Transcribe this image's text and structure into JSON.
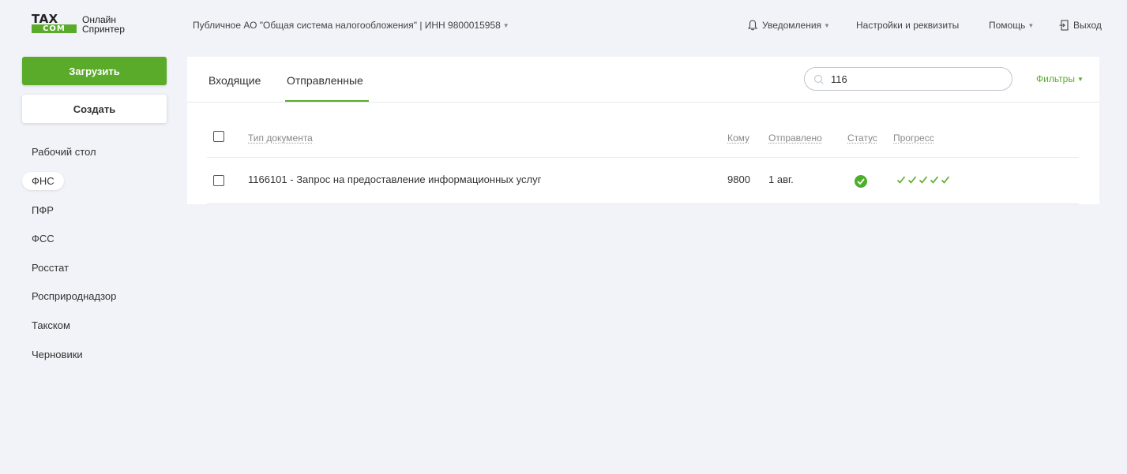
{
  "header": {
    "logo": {
      "mark_top": "TAX",
      "mark_bottom": "COM",
      "line1": "Онлайн",
      "line2": "Спринтер"
    },
    "organization": "Публичное АО \"Общая система налогообложения\" | ИНН 9800015958",
    "notifications_label": "Уведомления",
    "settings_label": "Настройки и реквизиты",
    "help_label": "Помощь",
    "logout_label": "Выход"
  },
  "sidebar": {
    "upload_label": "Загрузить",
    "create_label": "Создать",
    "items": [
      {
        "label": "Рабочий стол",
        "active": false
      },
      {
        "label": "ФНС",
        "active": true
      },
      {
        "label": "ПФР",
        "active": false
      },
      {
        "label": "ФСС",
        "active": false
      },
      {
        "label": "Росстат",
        "active": false
      },
      {
        "label": "Росприроднадзор",
        "active": false
      },
      {
        "label": "Такском",
        "active": false
      },
      {
        "label": "Черновики",
        "active": false
      }
    ]
  },
  "main": {
    "tabs": [
      {
        "label": "Входящие",
        "active": false
      },
      {
        "label": "Отправленные",
        "active": true
      }
    ],
    "search": {
      "value": "116",
      "placeholder": ""
    },
    "filters_label": "Фильтры",
    "table": {
      "columns": [
        "Тип документа",
        "Кому",
        "Отправлено",
        "Статус",
        "Прогресс"
      ],
      "rows": [
        {
          "doc_type": "1166101 - Запрос на предоставление информационных услуг",
          "to": "9800",
          "sent": "1 авг.",
          "status": "ok",
          "progress_steps": 5
        }
      ]
    }
  },
  "colors": {
    "accent": "#5aab2a",
    "background": "#f1f3f8"
  }
}
